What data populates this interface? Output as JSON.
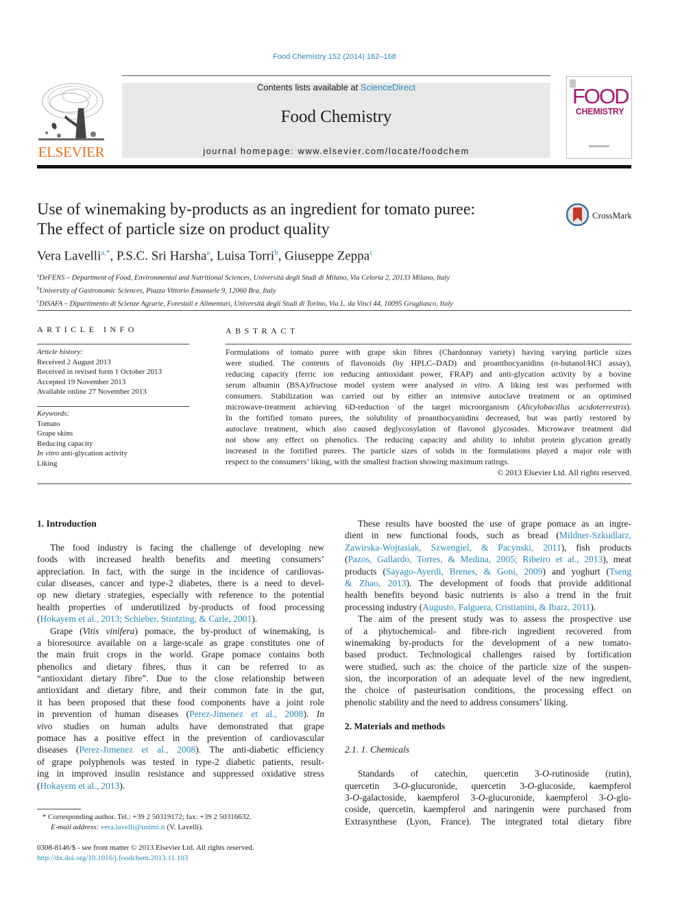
{
  "citation": "Food Chemistry 152 (2014) 162–168",
  "header": {
    "publisher_logo_text": "ELSEVIER",
    "contents_prefix": "Contents lists available at ",
    "contents_link": "ScienceDirect",
    "journal_name": "Food Chemistry",
    "homepage": "journal homepage: www.elsevier.com/locate/foodchem",
    "cover_line1": "FOOD",
    "cover_line2": "CHEMISTRY",
    "colors": {
      "publisher_orange": "#e9711c",
      "cover_magenta": "#a5186a",
      "link_blue": "#2a87b7",
      "masthead_gray": "#e8e8e8"
    }
  },
  "article": {
    "title_lines": [
      "Use of winemaking by-products as an ingredient for tomato puree:",
      "The effect of particle size on product quality"
    ],
    "crossmark_label": "CrossMark",
    "authors": [
      {
        "name": "Vera Lavelli",
        "sup": "a,*",
        "sep": ", "
      },
      {
        "name": "P.S.C. Sri Harsha",
        "sup": "a",
        "sep": ", "
      },
      {
        "name": "Luisa Torri",
        "sup": "b",
        "sep": ", "
      },
      {
        "name": "Giuseppe Zeppa",
        "sup": "c",
        "sep": ""
      }
    ],
    "affiliations": [
      {
        "sup": "a",
        "text": "DeFENS – Department of Food, Environmental and Nutritional Sciences, Università degli Studi di Milano, Via Celoria 2, 20133 Milano, Italy"
      },
      {
        "sup": "b",
        "text": "University of Gastronomic Sciences, Piazza Vittorio Emanuele 9, 12060 Bra, Italy"
      },
      {
        "sup": "c",
        "text": "DISAFA – Dipartimento di Scienze Agrarie, Forestali e Alimentari, Università degli Studi di Torino, Via L. da Vinci 44, 10095 Grugliasco, Italy"
      }
    ]
  },
  "article_info": {
    "heading": "ARTICLE INFO",
    "history_label": "Article history:",
    "history": [
      "Received 2 August 2013",
      "Received in revised form 1 October 2013",
      "Accepted 19 November 2013",
      "Available online 27 November 2013"
    ],
    "keywords_label": "Keywords:",
    "keywords": [
      {
        "ital": "",
        "text": "Tomato"
      },
      {
        "ital": "",
        "text": "Grape skins"
      },
      {
        "ital": "",
        "text": "Reducing capacity"
      },
      {
        "ital": "In vitro",
        "text": " anti-glycation activity"
      },
      {
        "ital": "",
        "text": "Liking"
      }
    ]
  },
  "abstract": {
    "heading": "ABSTRACT",
    "lines": [
      "Formulations of tomato puree with grape skin fibres (Chardonnay variety) having varying particle sizes",
      "were studied. The contents of flavonoids (by HPLC–DAD) and proanthocyanidins (<i>n</i>-butanol/HCl assay),",
      "reducing capacity (ferric ion reducing antioxidant power, FRAP) and anti-glycation activity by a bovine",
      "serum albumin (BSA)/fructose model system were analysed <i>in vitro</i>. A liking test was performed with",
      "consumers. Stabilization was carried out by either an intensive autoclave treatment or an optimised",
      "microwave-treatment achieving 6D-reduction of the target microorganism (<i>Alicylobacillus acidoterrestris</i>).",
      "In the fortified tomato purees, the solubility of proanthocyanidins decreased, but was partly restored by",
      "autoclave treatment, which also caused deglycosylation of flavonol glycosides. Microwave treatment did",
      "not show any effect on phenolics. The reducing capacity and ability to inhibit protein glycation greatly",
      "increased in the fortified purees. The particle sizes of solids in the formulations played a major role with",
      "respect to the consumers’ liking, with the smallest fraction showing maximum ratings."
    ],
    "copyright": "© 2013 Elsevier Ltd. All rights reserved."
  },
  "body": {
    "left": [
      {
        "type": "heading",
        "text": "1. Introduction"
      },
      {
        "type": "gap"
      },
      {
        "type": "para",
        "lines": [
          "The food industry is facing the challenge of developing new",
          "foods with increased health benefits and meeting consumers’",
          "appreciation. In fact, with the surge in the incidence of cardiovas-",
          "cular diseases, cancer and type-2 diabetes, there is a need to devel-",
          "op new dietary strategies, especially with reference to the potential",
          "health properties of underutilized by-products of food processing",
          "(<span class='link'>Hokayem et al., 2013; Schieber, Stintzing, &amp; Carle, 2001</span>)."
        ]
      },
      {
        "type": "para",
        "lines": [
          "Grape (<i>Vitis vinifera</i>) pomace, the by-product of winemaking, is",
          "a bioresource available on a large-scale as grape constitutes one of",
          "the main fruit crops in the world. Grape pomace contains both",
          "phenolics and dietary fibres, thus it can be referred to as",
          "“antioxidant dietary fibre”. Due to the close relationship between",
          "antioxidant and dietary fibre, and their common fate in the gut,",
          "it has been proposed that these food components have a joint role",
          "in prevention of human diseases (<span class='link'>Perez-Jimenez et al., 2008</span>). <i>In</i>",
          "<i>vivo</i> studies on human adults have demonstrated that grape",
          "pomace has a positive effect in the prevention of cardiovascular",
          "diseases (<span class='link'>Perez-Jimenez et al., 2008</span>). The anti-diabetic efficiency",
          "of grape polyphenols was tested in type-2 diabetic patients, result-",
          "ing in improved insulin resistance and suppressed oxidative stress",
          "(<span class='link'>Hokayem et al., 2013</span>)."
        ]
      }
    ],
    "right": [
      {
        "type": "para",
        "lines": [
          "These results have boosted the use of grape pomace as an ingre-",
          "dient in new functional foods, such as bread (<span class='link'>Mildner-Szkudlarz,</span>",
          "<span class='link'>Zawirska-Wojtasiak, Szwengiel, &amp; Pacynski, 2011</span>), fish products",
          "(<span class='link'>Pazos, Gallardo, Torres, &amp; Medina, 2005; Ribeiro et al., 2013</span>), meat",
          "products (<span class='link'>Sayago-Ayerdi, Brenes, &amp; Goni, 2009</span>) and yoghurt (<span class='link'>Tseng</span>",
          "<span class='link'>&amp; Zhao, 2013</span>). The development of foods that provide additional",
          "health benefits beyond basic nutrients is also a trend in the fruit",
          "processing industry (<span class='link'>Augusto, Falguera, Cristianini, &amp; Ibarz, 2011</span>)."
        ]
      },
      {
        "type": "para",
        "lines": [
          "The aim of the present study was to assess the prospective use",
          "of a phytochemical- and fibre-rich ingredient recovered from",
          "winemaking by-products for the development of a new tomato-",
          "based product. Technological challenges raised by fortification",
          "were studied, such as: the choice of the particle size of the suspen-",
          "sion, the incorporation of an adequate level of the new ingredient,",
          "the choice of pasteurisation conditions, the processing effect on",
          "phenolic stability and the need to address consumers’ liking."
        ]
      },
      {
        "type": "gap"
      },
      {
        "type": "heading",
        "text": "2. Materials and methods"
      },
      {
        "type": "gap"
      },
      {
        "type": "subheading",
        "text": "2.1. 1. Chemicals"
      },
      {
        "type": "gap"
      },
      {
        "type": "para",
        "noend": true,
        "lines": [
          "Standards of catechin, quercetin 3-<i>O</i>-rutinoside (rutin),",
          "quercetin 3-<i>O</i>-glucuronide, quercetin 3-<i>O</i>-glucoside, kaempferol",
          "3-<i>O</i>-galactoside, kaempferol 3-<i>O</i>-glucuronide, kaempferol 3-<i>O</i>-glu-",
          "coside, quercetin, kaempferol and naringenin were purchased from",
          "Extrasynthese (Lyon, France). The integrated total dietary fibre"
        ]
      }
    ]
  },
  "footnote": {
    "corresponding": "* Corresponding author. Tel.: +39 2 50319172; fax: +39 2 50316632.",
    "email_label": "E-mail address:",
    "email": "vera.lavelli@unimi.it",
    "email_suffix": " (V. Lavelli)."
  },
  "front_matter": {
    "issn_line": "0308-8146/$ - see front matter © 2013 Elsevier Ltd. All rights reserved.",
    "doi": "http://dx.doi.org/10.1016/j.foodchem.2013.11.103"
  }
}
